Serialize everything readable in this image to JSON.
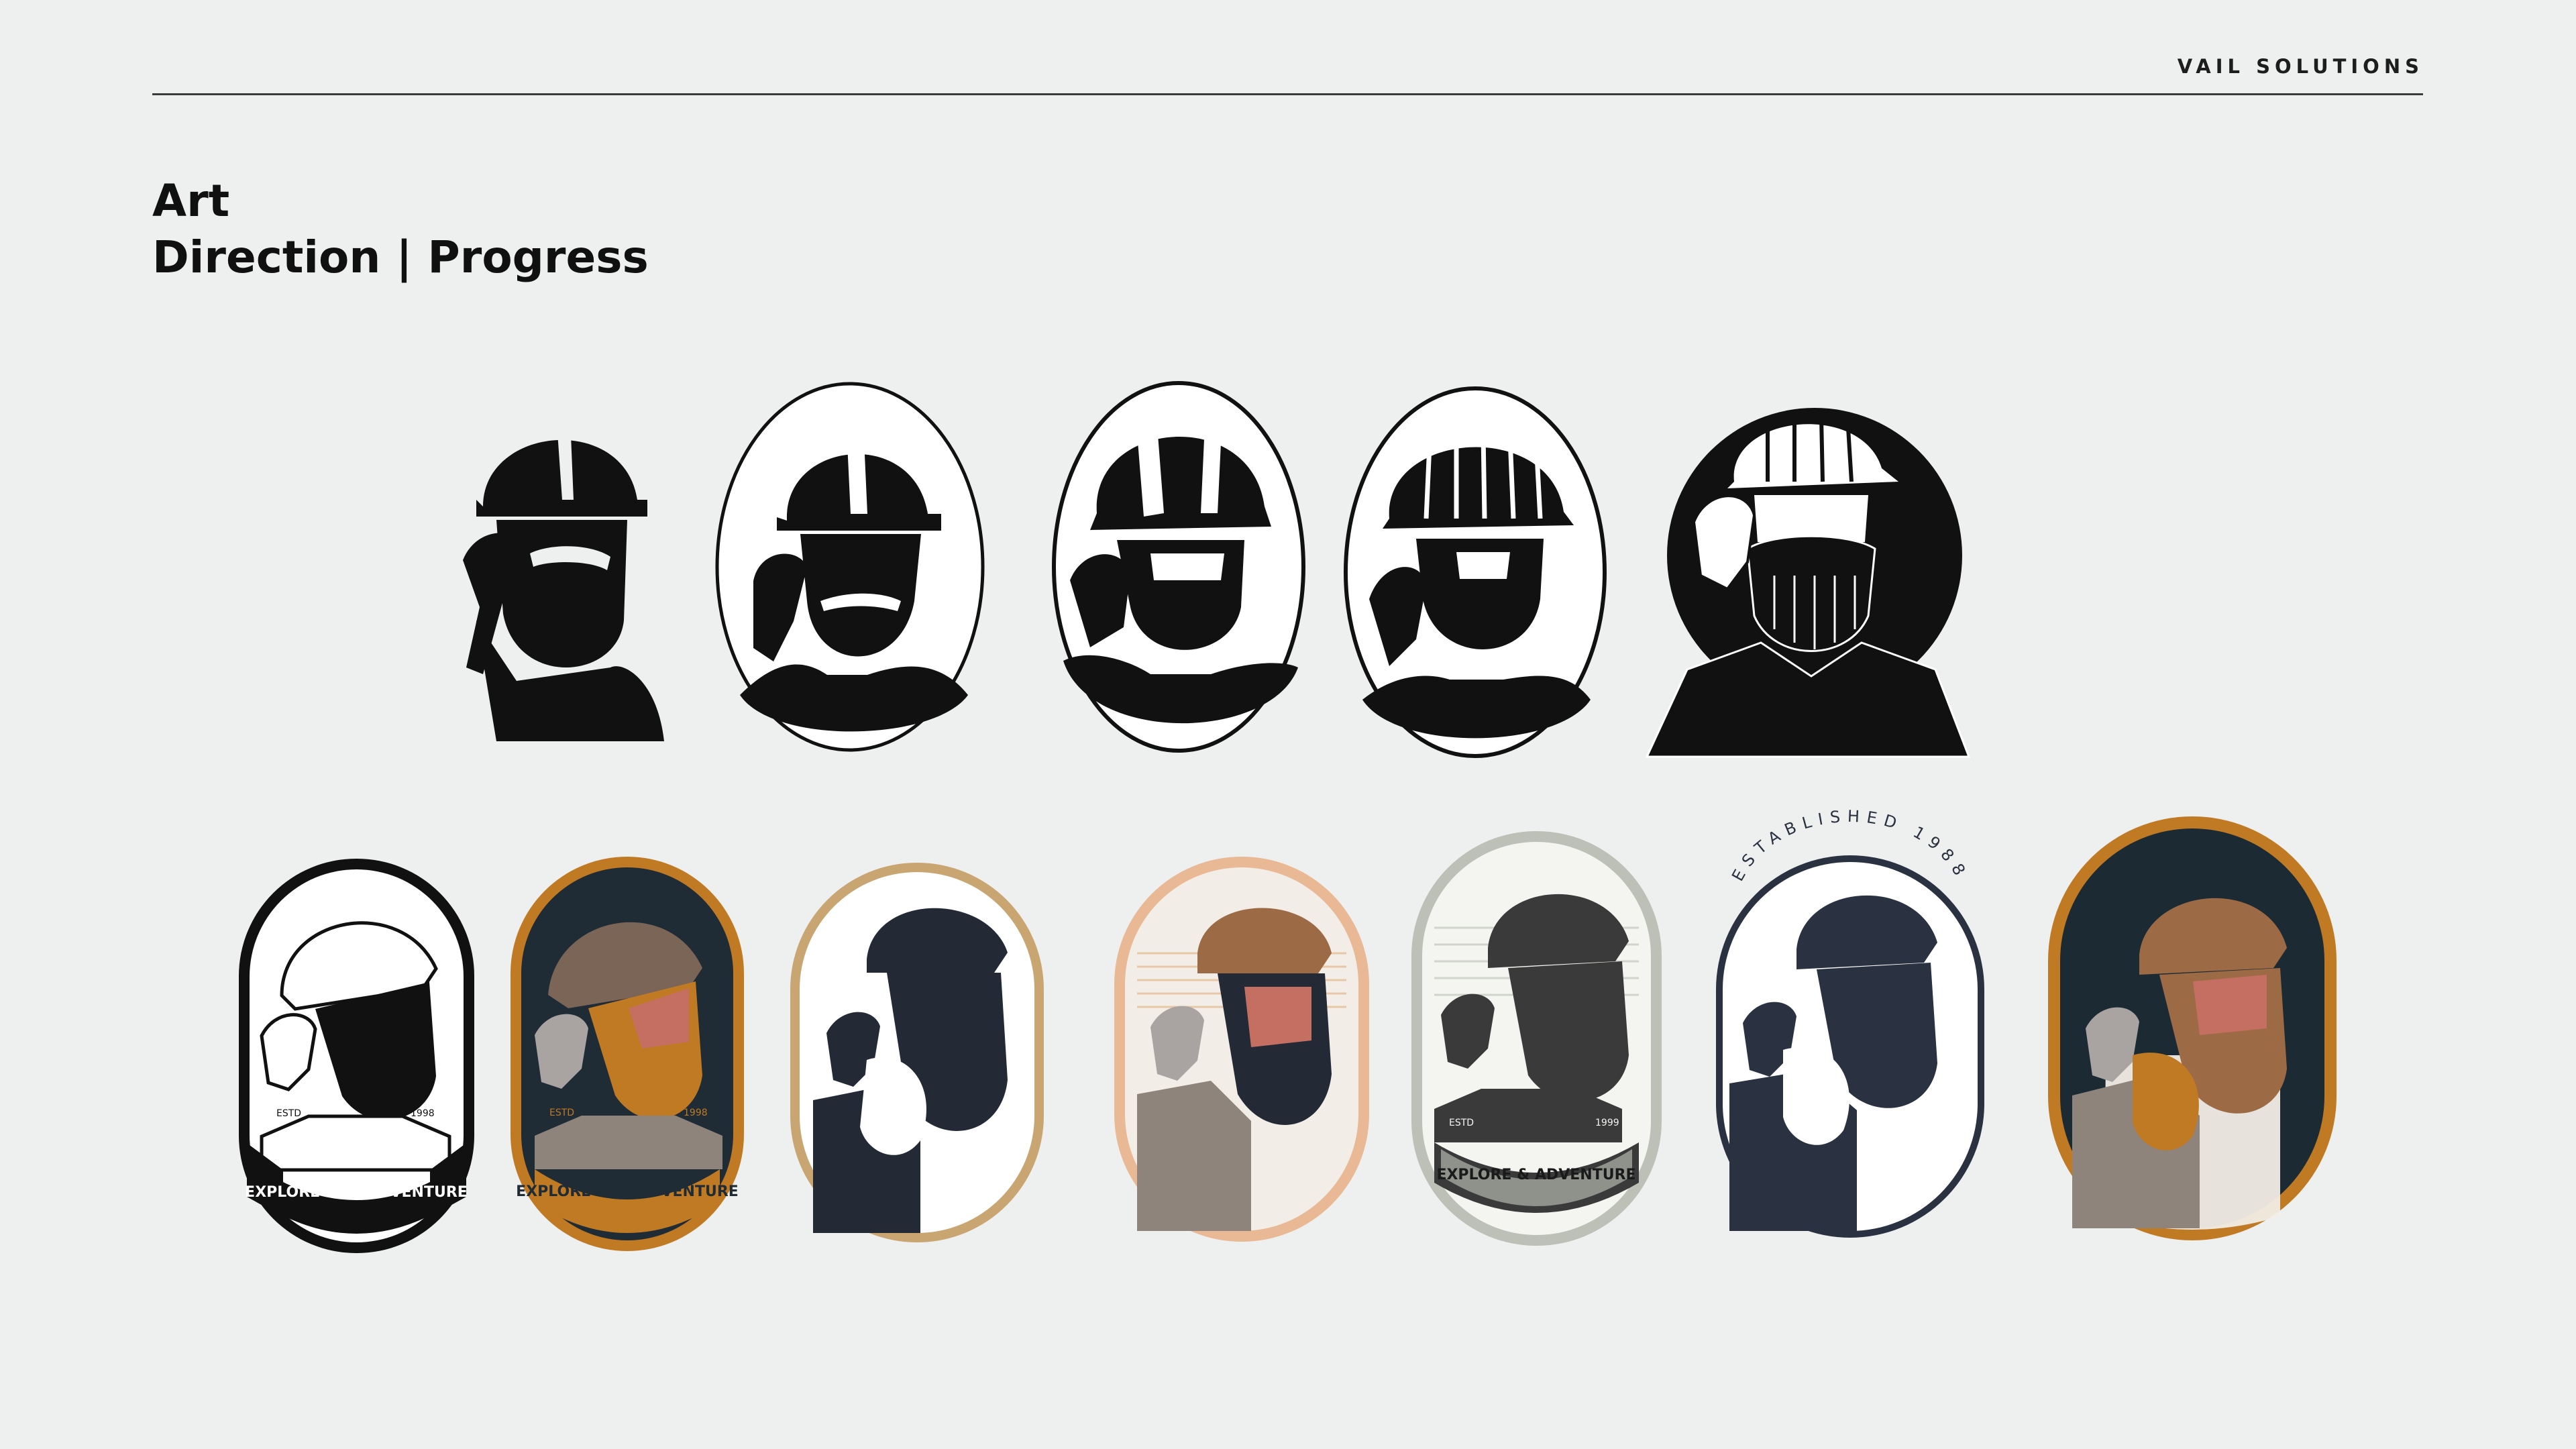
{
  "header": {
    "brand": "VAIL SOLUTIONS"
  },
  "title": {
    "line1": "Art",
    "line2": "Direction | Progress"
  },
  "sketch_row": [
    {
      "id": "sketch-1",
      "style": "silhouette"
    },
    {
      "id": "sketch-2",
      "style": "oval-outline"
    },
    {
      "id": "sketch-3",
      "style": "oval-outline-rough"
    },
    {
      "id": "sketch-4",
      "style": "oval-engraved"
    },
    {
      "id": "sketch-5",
      "style": "circle-suit"
    }
  ],
  "badges": [
    {
      "id": "badge-1",
      "frame": "#111111",
      "bg": "#FFFFFF",
      "helmet": "#FFFFFF",
      "beard": "#111111",
      "banner": "EXPLORE AND ADVENTURE",
      "estd": "ESTD",
      "year": "1998"
    },
    {
      "id": "badge-2",
      "frame": "#C07A24",
      "bg": "#1F2B35",
      "helmet": "#7A6556",
      "beard": "#C07A24",
      "banner": "EXPLORE AND ADVENTURE",
      "estd": "ESTD",
      "year": "1998"
    },
    {
      "id": "badge-3",
      "frame": "#C9A571",
      "bg": "#FFFFFF",
      "helmet": "#232A36",
      "beard": "#FFFFFF"
    },
    {
      "id": "badge-4",
      "frame": "#E9B894",
      "bg": "#F2EDE6",
      "helmet": "#9C6B46",
      "beard": "#FFFFFF"
    },
    {
      "id": "badge-5",
      "frame": "#BCC0B6",
      "bg": "#F4F5F1",
      "helmet": "#3A3A3A",
      "beard": "#FFFFFF",
      "banner": "EXPLORE & ADVENTURE",
      "estd": "ESTD",
      "year": "1999"
    },
    {
      "id": "badge-6",
      "frame": "#2A3140",
      "bg": "#FFFFFF",
      "helmet": "#2A3140",
      "beard": "#FFFFFF",
      "arc_text": "ESTABLISHED 1988"
    },
    {
      "id": "badge-7",
      "frame": "#C07A24",
      "bg": "#1C2A34",
      "helmet": "#9C6B46",
      "beard": "#C07A24"
    }
  ]
}
